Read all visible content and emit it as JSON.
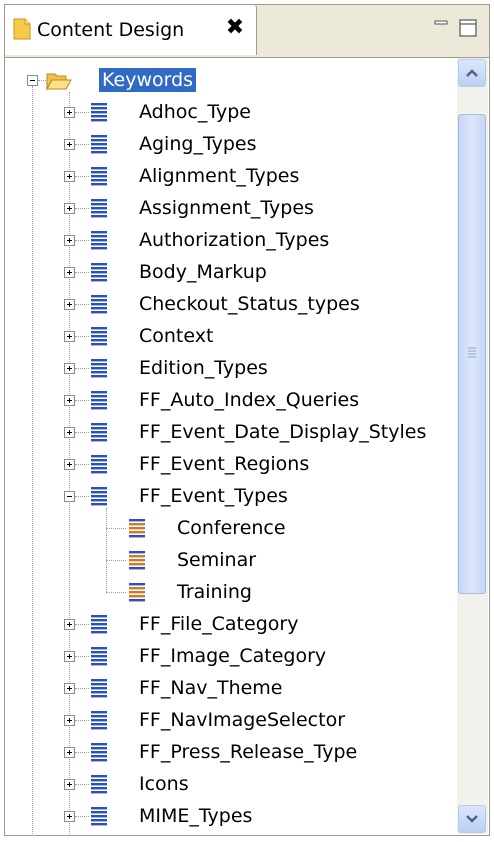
{
  "view": {
    "tab_title": "Content Design",
    "close_glyph": "✖"
  },
  "tree": {
    "root": {
      "label": "Keywords",
      "expanded": true,
      "selected": true
    },
    "items": [
      {
        "label": "Adhoc_Type",
        "expanded": false
      },
      {
        "label": "Aging_Types",
        "expanded": false
      },
      {
        "label": "Alignment_Types",
        "expanded": false
      },
      {
        "label": "Assignment_Types",
        "expanded": false
      },
      {
        "label": "Authorization_Types",
        "expanded": false
      },
      {
        "label": "Body_Markup",
        "expanded": false
      },
      {
        "label": "Checkout_Status_types",
        "expanded": false
      },
      {
        "label": "Context",
        "expanded": false
      },
      {
        "label": "Edition_Types",
        "expanded": false
      },
      {
        "label": "FF_Auto_Index_Queries",
        "expanded": false
      },
      {
        "label": "FF_Event_Date_Display_Styles",
        "expanded": false
      },
      {
        "label": "FF_Event_Regions",
        "expanded": false
      },
      {
        "label": "FF_Event_Types",
        "expanded": true,
        "children": [
          {
            "label": "Conference"
          },
          {
            "label": "Seminar"
          },
          {
            "label": "Training"
          }
        ]
      },
      {
        "label": "FF_File_Category",
        "expanded": false
      },
      {
        "label": "FF_Image_Category",
        "expanded": false
      },
      {
        "label": "FF_Nav_Theme",
        "expanded": false
      },
      {
        "label": "FF_NavImageSelector",
        "expanded": false
      },
      {
        "label": "FF_Press_Release_Type",
        "expanded": false
      },
      {
        "label": "Icons",
        "expanded": false
      },
      {
        "label": "MIME_Types",
        "expanded": false
      }
    ]
  },
  "colors": {
    "selection": "#316ac5",
    "frame_bg": "#ece9d8",
    "doc_icon_blue": "#2a4fb8",
    "child_icon_orange": "#d07a2a"
  }
}
